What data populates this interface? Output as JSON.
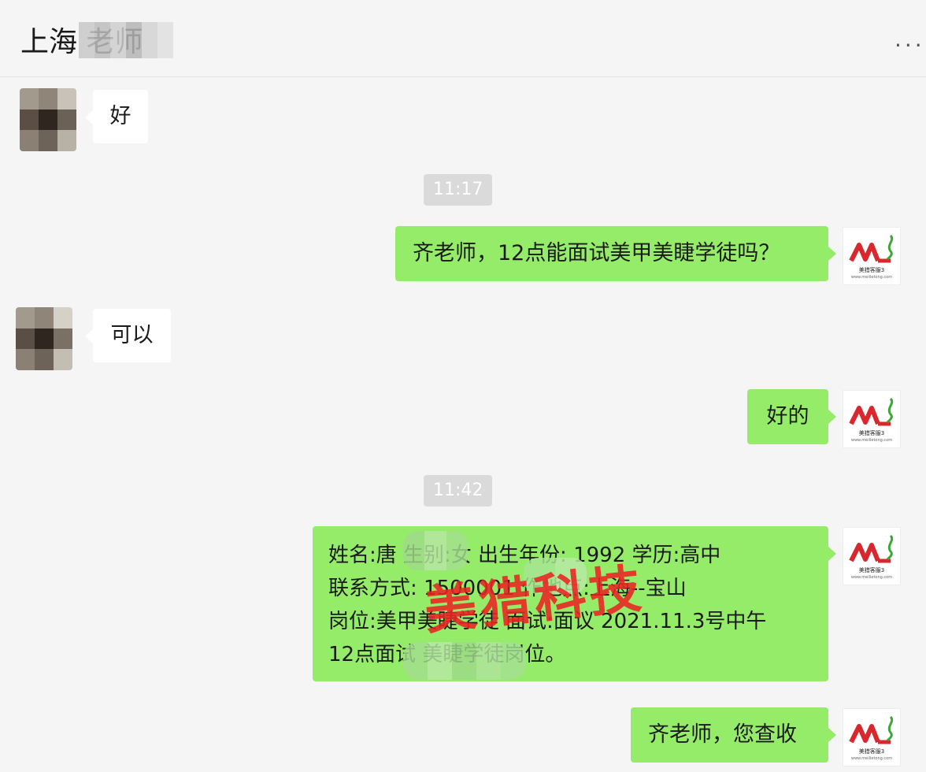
{
  "header": {
    "title": "上海       老师",
    "more_label": "..."
  },
  "messages": [
    {
      "side": "in",
      "text": "好"
    },
    {
      "type": "time",
      "text": "11:17"
    },
    {
      "side": "out",
      "text": "齐老师，12点能面试美甲美睫学徒吗？"
    },
    {
      "side": "in",
      "text": "可以"
    },
    {
      "side": "out",
      "text": "好的"
    },
    {
      "type": "time",
      "text": "11:42"
    },
    {
      "side": "out",
      "lines": [
        "姓名:唐        生别:女 出生年份: 1992 学历:高中",
        "联系方式: 1500001        作地点:上海--宝山",
        "岗位:美甲美睫学徒 面试:面议 2021.11.3号中午",
        "12点面试         美睫学徒岗位。"
      ]
    },
    {
      "side": "out",
      "text": "齐老师，您查收"
    }
  ],
  "brand_avatar": {
    "name_small": "美猎客服3",
    "site_small": "www.meilietong.com",
    "logo_color": "#d9272e",
    "leaf_color": "#3aa835"
  },
  "watermark": "美猎科技",
  "colors": {
    "bubble_out": "#95ec69",
    "bubble_in": "#ffffff",
    "background": "#f5f5f5",
    "time_bg": "#dadada"
  }
}
